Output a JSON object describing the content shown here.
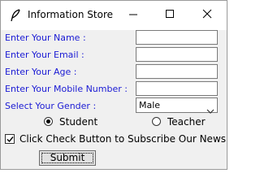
{
  "window": {
    "title": "Information Store",
    "icon": "feather-icon",
    "controls": [
      "minimize-icon",
      "maximize-icon",
      "close-icon"
    ]
  },
  "form": {
    "labels": {
      "name": "Enter Your Name :",
      "email": "Enter Your Email :",
      "age": "Enter Your Age :",
      "mobile": "Enter Your Mobile Number :",
      "gender": "Select Your Gender :"
    },
    "values": {
      "name": "",
      "email": "",
      "age": "",
      "mobile": ""
    },
    "gender_selected": "Male",
    "radio": {
      "student": "Student",
      "teacher": "Teacher",
      "selected": "student"
    },
    "checkbox": {
      "label": "Click Check Button to Subscribe Our Newsletter",
      "checked": true
    },
    "submit_label": "Submit"
  },
  "colors": {
    "label": "#1a1ad4",
    "window_bg": "#f0f0f0",
    "titlebar_bg": "#ffffff"
  }
}
